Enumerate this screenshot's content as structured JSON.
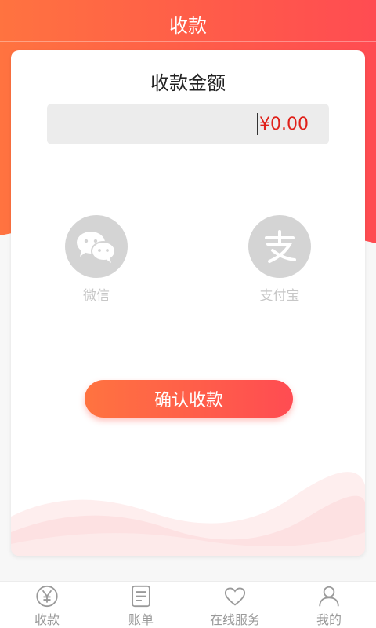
{
  "header": {
    "title": "收款"
  },
  "card": {
    "title": "收款金额",
    "amount": "¥0.00",
    "amount_color": "#e0211a"
  },
  "payment_methods": [
    {
      "label": "微信",
      "icon": "wechat-icon"
    },
    {
      "label": "支付宝",
      "icon": "alipay-icon"
    }
  ],
  "confirm_button": {
    "label": "确认收款"
  },
  "tabbar": {
    "items": [
      {
        "label": "收款",
        "icon": "yen-circle-icon"
      },
      {
        "label": "账单",
        "icon": "bill-icon"
      },
      {
        "label": "在线服务",
        "icon": "heart-icon"
      },
      {
        "label": "我的",
        "icon": "user-icon"
      }
    ]
  },
  "colors": {
    "accent_start": "#ff7340",
    "accent_end": "#ff4c52",
    "icon_inactive": "#d4d4d4"
  }
}
